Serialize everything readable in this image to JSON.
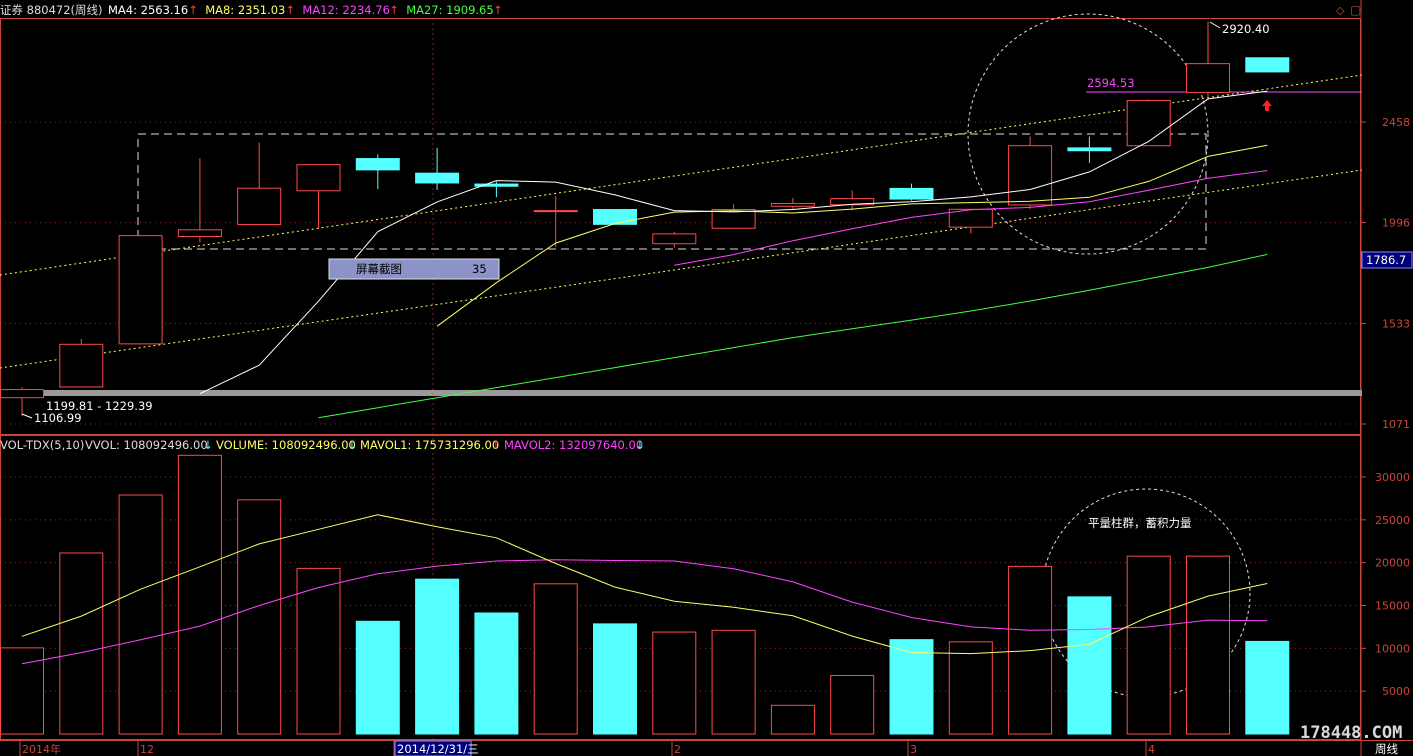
{
  "header": {
    "title": "证券 880472(周线)",
    "ma_items": [
      {
        "label": "MA4: 2563.16",
        "color": "#ffffff"
      },
      {
        "label": "MA8: 2351.03",
        "color": "#ffff66"
      },
      {
        "label": "MA12: 2234.76",
        "color": "#ff44ff"
      },
      {
        "label": "MA27: 1909.65",
        "color": "#44ff44"
      }
    ],
    "up_arrow": "↑"
  },
  "volume_header": {
    "indicator": "VOL-TDX(5,10)",
    "items": [
      {
        "label": "VVOL: 108092496.00",
        "color": "#dddddd",
        "arrow": "↓"
      },
      {
        "label": "VOLUME: 108092496.00",
        "color": "#ffff66",
        "arrow": "↓"
      },
      {
        "label": "MAVOL1: 175731296.00",
        "color": "#ffff66",
        "arrow": "↑"
      },
      {
        "label": "MAVOL2: 132097640.00",
        "color": "#ff44ff",
        "arrow": "↓"
      }
    ]
  },
  "tooltip": {
    "label": "屏幕截图",
    "value": "35"
  },
  "price_panel": {
    "y_ticks": [
      "2458",
      "1996",
      "1533",
      "1071"
    ],
    "last_price": "1786.7",
    "annotations": {
      "high": "2920.40",
      "level": "2594.53",
      "low_range": "1199.81 - 1229.39",
      "low": "1106.99"
    }
  },
  "volume_panel": {
    "y_ticks": [
      "30000",
      "25000",
      "20000",
      "15000",
      "10000",
      "5000"
    ],
    "note": "平量柱群，蓄积力量"
  },
  "x_axis": {
    "labels": [
      "2014年",
      "12",
      "2014/12/31/三",
      "2",
      "3",
      "4"
    ],
    "period": "周线"
  },
  "watermark": "178448.COM",
  "colors": {
    "up": "#ff4a4a",
    "down": "#55ffff",
    "ma4": "#ffffff",
    "ma8": "#ffff66",
    "ma12": "#ff44ff",
    "ma27": "#44ff44",
    "axis": "#c8463c"
  },
  "chart_data": {
    "type": "candlestick",
    "candles": [
      {
        "open": 1192,
        "close": 1229,
        "high": 1240,
        "low": 1107
      },
      {
        "open": 1241,
        "close": 1437,
        "high": 1462,
        "low": 1240
      },
      {
        "open": 1439,
        "close": 1936,
        "high": 1940,
        "low": 1436
      },
      {
        "open": 1932,
        "close": 1963,
        "high": 2292,
        "low": 1905
      },
      {
        "open": 1987,
        "close": 2154,
        "high": 2364,
        "low": 1987
      },
      {
        "open": 2142,
        "close": 2262,
        "high": 2262,
        "low": 1969
      },
      {
        "open": 2290,
        "close": 2238,
        "high": 2309,
        "low": 2150
      },
      {
        "open": 2223,
        "close": 2178,
        "high": 2339,
        "low": 2146
      },
      {
        "open": 2173,
        "close": 2163,
        "high": 2184,
        "low": 2112
      },
      {
        "open": 2051,
        "close": 2051,
        "high": 2117,
        "low": 1885
      },
      {
        "open": 2056,
        "close": 1988,
        "high": 2056,
        "low": 1988
      },
      {
        "open": 1899,
        "close": 1944,
        "high": 1953,
        "low": 1882
      },
      {
        "open": 1970,
        "close": 2056,
        "high": 2081,
        "low": 1970
      },
      {
        "open": 2071,
        "close": 2084,
        "high": 2110,
        "low": 2059
      },
      {
        "open": 2078,
        "close": 2106,
        "high": 2143,
        "low": 2054
      },
      {
        "open": 2153,
        "close": 2104,
        "high": 2175,
        "low": 2097
      },
      {
        "open": 1975,
        "close": 2057,
        "high": 2057,
        "low": 1946
      },
      {
        "open": 2077,
        "close": 2349,
        "high": 2391,
        "low": 2059
      },
      {
        "open": 2339,
        "close": 2326,
        "high": 2391,
        "low": 2270
      },
      {
        "open": 2349,
        "close": 2557,
        "high": 2561,
        "low": 2349
      },
      {
        "open": 2594,
        "close": 2726,
        "high": 2920,
        "low": 2561
      },
      {
        "open": 2753,
        "close": 2688,
        "high": 2753,
        "low": 2688
      }
    ],
    "ma4": [
      null,
      null,
      null,
      1210,
      1341,
      1635,
      1954,
      2091,
      2189,
      2182,
      2123,
      2051,
      2045,
      2056,
      2080,
      2092,
      2114,
      2148,
      2229,
      2369,
      2564,
      2600
    ],
    "ma8": [
      null,
      null,
      null,
      null,
      null,
      null,
      null,
      1520,
      1720,
      1902,
      1992,
      2044,
      2050,
      2040,
      2058,
      2082,
      2088,
      2094,
      2112,
      2185,
      2300,
      2351
    ],
    "ma12": [
      null,
      null,
      null,
      null,
      null,
      null,
      null,
      null,
      null,
      null,
      null,
      1800,
      1849,
      1913,
      1968,
      2020,
      2055,
      2066,
      2092,
      2145,
      2200,
      2235
    ],
    "ma27": [
      null,
      null,
      null,
      null,
      null,
      1100,
      1146,
      1192,
      1238,
      1284,
      1330,
      1376,
      1422,
      1468,
      1508,
      1548,
      1590,
      1636,
      1685,
      1738,
      1790,
      1850
    ],
    "volume": [
      10054,
      21130,
      27897,
      32534,
      27332,
      19335,
      13157,
      18076,
      14127,
      17531,
      12857,
      11900,
      12105,
      3347,
      6827,
      11016,
      10761,
      19572,
      16008,
      20761,
      20762,
      10809
    ],
    "mavol1": [
      11408,
      13760,
      16902,
      19522,
      22196,
      23890,
      25590,
      24200,
      22900,
      19900,
      17150,
      15500,
      14800,
      13800,
      11430,
      9510,
      9380,
      9740,
      10480,
      13700,
      16100,
      17573
    ],
    "mavol2": [
      8200,
      9500,
      11000,
      12600,
      15000,
      17100,
      18700,
      19600,
      20200,
      20350,
      20250,
      20200,
      19300,
      17750,
      15400,
      13600,
      12500,
      12100,
      12200,
      12500,
      13300,
      13210
    ],
    "x_tick_labels": [
      "2014年",
      "12",
      "2014/12/31/三",
      "2",
      "3",
      "4"
    ],
    "price_axis": {
      "ticks": [
        2458,
        1996,
        1533,
        1071
      ],
      "last": 1786.7
    },
    "volume_axis": {
      "ticks": [
        30000,
        25000,
        20000,
        15000,
        10000,
        5000
      ],
      "max": 34000
    },
    "horizontal_levels": [
      2594.53
    ],
    "peak_label": 2920.4
  }
}
